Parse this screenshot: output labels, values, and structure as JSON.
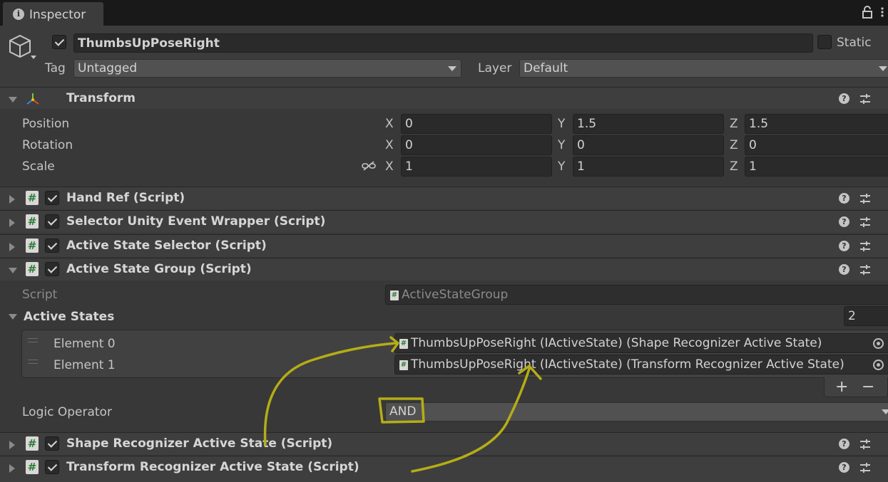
{
  "window": {
    "tab_label": "Inspector"
  },
  "object": {
    "name": "ThumbsUpPoseRight",
    "static_label": "Static",
    "tag_label": "Tag",
    "tag_value": "Untagged",
    "layer_label": "Layer",
    "layer_value": "Default"
  },
  "transform": {
    "title": "Transform",
    "position_label": "Position",
    "rotation_label": "Rotation",
    "scale_label": "Scale",
    "axis_x": "X",
    "axis_y": "Y",
    "axis_z": "Z",
    "position": {
      "x": "0",
      "y": "1.5",
      "z": "1.5"
    },
    "rotation": {
      "x": "0",
      "y": "0",
      "z": "0"
    },
    "scale": {
      "x": "1",
      "y": "1",
      "z": "1"
    }
  },
  "components": {
    "hand_ref": "Hand Ref (Script)",
    "selector_wrapper": "Selector Unity Event Wrapper (Script)",
    "active_state_selector": "Active State Selector (Script)",
    "active_state_group": "Active State Group (Script)",
    "shape_recognizer": "Shape Recognizer Active State (Script)",
    "transform_recognizer": "Transform Recognizer Active State (Script)"
  },
  "group": {
    "script_label": "Script",
    "script_value": "ActiveStateGroup",
    "active_states_label": "Active States",
    "active_states_count": "2",
    "elements": [
      {
        "label": "Element 0",
        "value": "ThumbsUpPoseRight (IActiveState) (Shape Recognizer Active State)"
      },
      {
        "label": "Element 1",
        "value": "ThumbsUpPoseRight (IActiveState) (Transform Recognizer Active State)"
      }
    ],
    "add_label": "+",
    "remove_label": "−",
    "logic_operator_label": "Logic Operator",
    "logic_operator_value": "AND"
  },
  "icons": {
    "info": "info-icon",
    "lock": "lock-icon",
    "gameobject": "cube-icon",
    "transform": "transform-axes-icon",
    "script": "script-hash-icon",
    "help": "help-icon",
    "preset": "preset-sliders-icon",
    "link": "constrain-proportions-icon",
    "target": "object-picker-icon"
  },
  "colors": {
    "annotation": "#b5ad16",
    "background": "#383838",
    "header": "#3e3e3e"
  }
}
